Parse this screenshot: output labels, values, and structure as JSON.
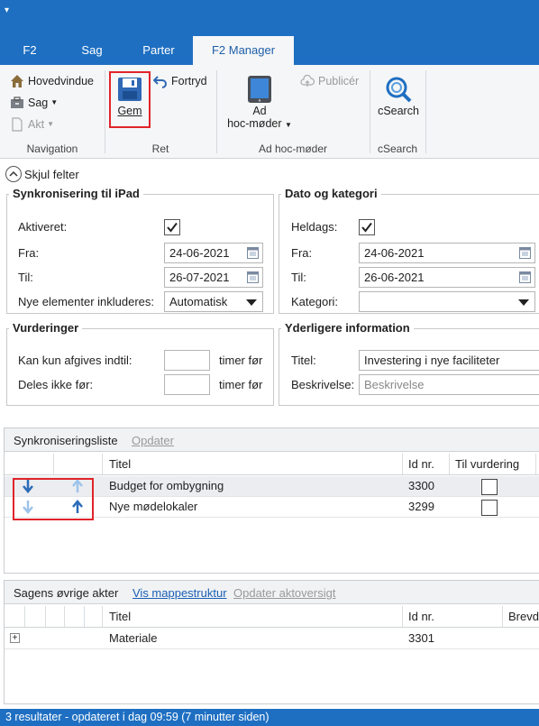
{
  "ribbon_tabs": [
    "F2",
    "Sag",
    "Parter",
    "F2 Manager"
  ],
  "ribbon": {
    "navigation": {
      "hovedvindue": "Hovedvindue",
      "sag": "Sag",
      "akt": "Akt",
      "group_label": "Navigation"
    },
    "ret": {
      "gem": "Gem",
      "fortryd": "Fortryd",
      "group_label": "Ret"
    },
    "adhoc": {
      "ad": "Ad",
      "hoc_moder": "hoc-møder",
      "publicer": "Publicér",
      "group_label": "Ad hoc-møder"
    },
    "csearch": {
      "button": "cSearch",
      "group_label": "cSearch"
    }
  },
  "toggle_fields": "Skjul felter",
  "sync": {
    "title": "Synkronisering til iPad",
    "aktiveret_label": "Aktiveret:",
    "aktiveret": true,
    "fra_label": "Fra:",
    "fra": "24-06-2021",
    "til_label": "Til:",
    "til": "26-07-2021",
    "nye_label": "Nye elementer inkluderes:",
    "nye": "Automatisk"
  },
  "dato": {
    "title": "Dato og kategori",
    "heldags_label": "Heldags:",
    "heldags": true,
    "fra_label": "Fra:",
    "fra": "24-06-2021",
    "til_label": "Til:",
    "til": "26-06-2021",
    "kategori_label": "Kategori:",
    "kategori": ""
  },
  "vurderinger": {
    "title": "Vurderinger",
    "afgives_label": "Kan kun afgives indtil:",
    "afgives_value": "",
    "afgives_unit": "timer før",
    "deles_label": "Deles ikke før:",
    "deles_value": "",
    "deles_unit": "timer før"
  },
  "yderligere": {
    "title": "Yderligere information",
    "titel_label": "Titel:",
    "titel": "Investering i nye faciliteter",
    "beskrivelse_label": "Beskrivelse:",
    "beskrivelse_placeholder": "Beskrivelse"
  },
  "synclist": {
    "title": "Synkroniseringsliste",
    "opdater": "Opdater",
    "columns": [
      "Titel",
      "Id nr.",
      "Til vurdering"
    ],
    "rows": [
      {
        "title": "Budget for ombygning",
        "id": "3300",
        "til_vurdering": false
      },
      {
        "title": "Nye mødelokaler",
        "id": "3299",
        "til_vurdering": false
      }
    ]
  },
  "sagens": {
    "title": "Sagens øvrige akter",
    "vis_mappestruktur": "Vis mappestruktur",
    "opdater_aktoversigt": "Opdater aktoversigt",
    "columns": [
      "Titel",
      "Id nr.",
      "Brevd"
    ],
    "rows": [
      {
        "expand": "+",
        "title": "Materiale",
        "id": "3301"
      }
    ]
  },
  "status": "3 resultater - opdateret i dag 09:59 (7 minutter siden)",
  "colors": {
    "brand_blue": "#1e6fc2",
    "highlight_red": "#e0242a",
    "link_blue": "#1a5fb4",
    "disabled_gray": "#9a9a9a"
  }
}
